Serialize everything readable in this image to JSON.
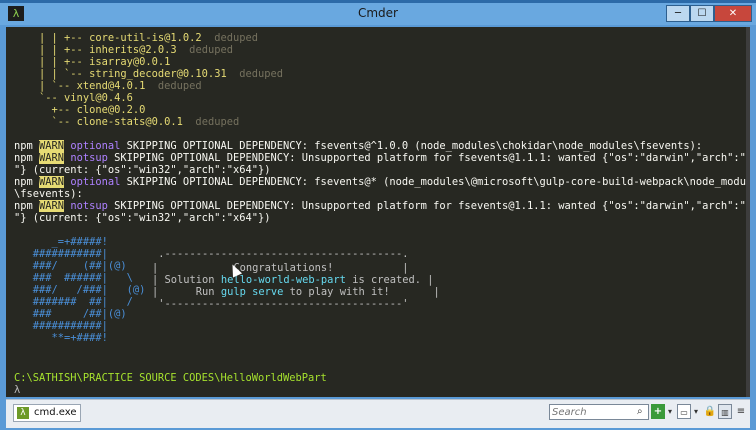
{
  "window": {
    "title": "Cmder",
    "app_icon": "λ",
    "min": "─",
    "max": "☐",
    "close": "✕"
  },
  "terminal": {
    "tree": [
      {
        "p": "    | | +-- ",
        "pkg": "core-util-is@1.0.2",
        "d": "  deduped"
      },
      {
        "p": "    | | +-- ",
        "pkg": "inherits@2.0.3",
        "d": "  deduped"
      },
      {
        "p": "    | | +-- ",
        "pkg": "isarray@0.0.1",
        "d": ""
      },
      {
        "p": "    | | `-- ",
        "pkg": "string_decoder@0.10.31",
        "d": "  deduped"
      },
      {
        "p": "    | `-- ",
        "pkg": "xtend@4.0.1",
        "d": "  deduped"
      },
      {
        "p": "    `-- ",
        "pkg": "vinyl@0.4.6",
        "d": ""
      },
      {
        "p": "      +-- ",
        "pkg": "clone@0.2.0",
        "d": ""
      },
      {
        "p": "      `-- ",
        "pkg": "clone-stats@0.0.1",
        "d": "  deduped"
      }
    ],
    "warn_lines": [
      {
        "npm": "npm ",
        "warn": "WARN",
        "kind": " optional",
        "msg": " SKIPPING OPTIONAL DEPENDENCY: fsevents@^1.0.0 (node_modules\\chokidar\\node_modules\\fsevents):"
      },
      {
        "npm": "npm ",
        "warn": "WARN",
        "kind": " notsup",
        "msg": " SKIPPING OPTIONAL DEPENDENCY: Unsupported platform for fsevents@1.1.1: wanted {\"os\":\"darwin\",\"arch\":\"any"
      },
      {
        "npm": "",
        "warn": "",
        "kind": "",
        "msg": "\"} (current: {\"os\":\"win32\",\"arch\":\"x64\"})"
      },
      {
        "npm": "npm ",
        "warn": "WARN",
        "kind": " optional",
        "msg": " SKIPPING OPTIONAL DEPENDENCY: fsevents@* (node_modules\\@microsoft\\gulp-core-build-webpack\\node_modules"
      },
      {
        "npm": "",
        "warn": "",
        "kind": "",
        "msg": "\\fsevents):"
      },
      {
        "npm": "npm ",
        "warn": "WARN",
        "kind": " notsup",
        "msg": " SKIPPING OPTIONAL DEPENDENCY: Unsupported platform for fsevents@1.1.1: wanted {\"os\":\"darwin\",\"arch\":\"any"
      },
      {
        "npm": "",
        "warn": "",
        "kind": "",
        "msg": "\"} (current: {\"os\":\"win32\",\"arch\":\"x64\"})"
      }
    ],
    "logo": [
      "      _=+#####!",
      "   ###########|",
      "   ###/    (##|(@)",
      "   ###  ######|   \\",
      "   ###/   /###|   (@)",
      "   #######  ##|   /",
      "   ###     /##|(@)",
      "   ###########|",
      "      **=+####!"
    ],
    "box": {
      "top": " .--------------------------------------.",
      "line1": "|            Congratulations!           |",
      "line2_pre": "| Solution ",
      "line2_hl": "hello-world-web-part",
      "line2_post": " is created. |",
      "line3_pre": "|      Run ",
      "line3_hl": "gulp serve",
      "line3_post": " to play with it!       |",
      "bottom": " '--------------------------------------'"
    },
    "prompt_path": "C:\\SATHISH\\PRACTICE SOURCE CODES\\HelloWorldWebPart",
    "prompt_symbol": "λ"
  },
  "taskbar": {
    "tab_icon": "λ",
    "tab_label": "cmd.exe",
    "search_placeholder": "Search",
    "search_icon": "⌕",
    "plus": "+",
    "drop": "▾",
    "console": "▭",
    "lock": "🔒",
    "split": "▥",
    "menu": "≡"
  },
  "colors": {
    "warn_bg": "#e6db74",
    "optional": "#ae81ff",
    "path": "#a6e22e",
    "highlight": "#66d9ef"
  }
}
